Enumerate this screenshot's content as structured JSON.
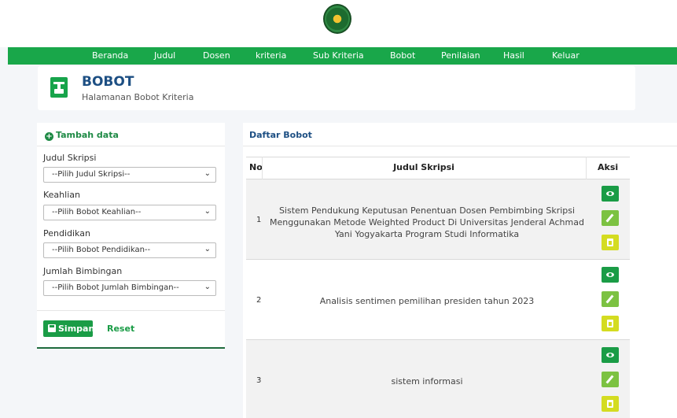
{
  "nav": {
    "items": [
      "Beranda",
      "Judul",
      "Dosen",
      "kriteria",
      "Sub Kriteria",
      "Bobot",
      "Penilaian",
      "Hasil",
      "Keluar"
    ]
  },
  "header": {
    "title": "BOBOT",
    "subtitle": "Halamanan Bobot Kriteria"
  },
  "form": {
    "heading": "Tambah data",
    "fields": [
      {
        "label": "Judul Skripsi",
        "selected": "--Pilih Judul Skripsi--"
      },
      {
        "label": "Keahlian",
        "selected": "--Pilih Bobot Keahlian--"
      },
      {
        "label": "Pendidikan",
        "selected": "--Pilih Bobot Pendidikan--"
      },
      {
        "label": "Jumlah Bimbingan",
        "selected": "--Pilih Bobot Jumlah Bimbingan--"
      }
    ],
    "save_label": "Simpan",
    "reset_label": "Reset"
  },
  "list": {
    "heading": "Daftar Bobot",
    "columns": [
      "No",
      "Judul Skripsi",
      "Aksi"
    ],
    "rows": [
      {
        "no": "1",
        "title": "Sistem Pendukung Keputusan Penentuan Dosen Pembimbing Skripsi Menggunakan Metode Weighted Product Di Universitas Jenderal Achmad Yani Yogyakarta Program Studi Informatika"
      },
      {
        "no": "2",
        "title": "Analisis sentimen pemilihan presiden tahun 2023"
      },
      {
        "no": "3",
        "title": "sistem informasi"
      }
    ]
  },
  "colors": {
    "nav_bg": "#19a74a",
    "accent_blue": "#1d4f83",
    "view_btn": "#1a9c46",
    "edit_btn": "#7cc242",
    "delete_btn": "#d4dc21"
  },
  "icons": [
    "university-logo-icon",
    "scale-icon",
    "plus-circle-icon",
    "save-icon",
    "eye-icon",
    "pencil-icon",
    "trash-icon",
    "chevron-down-icon"
  ]
}
